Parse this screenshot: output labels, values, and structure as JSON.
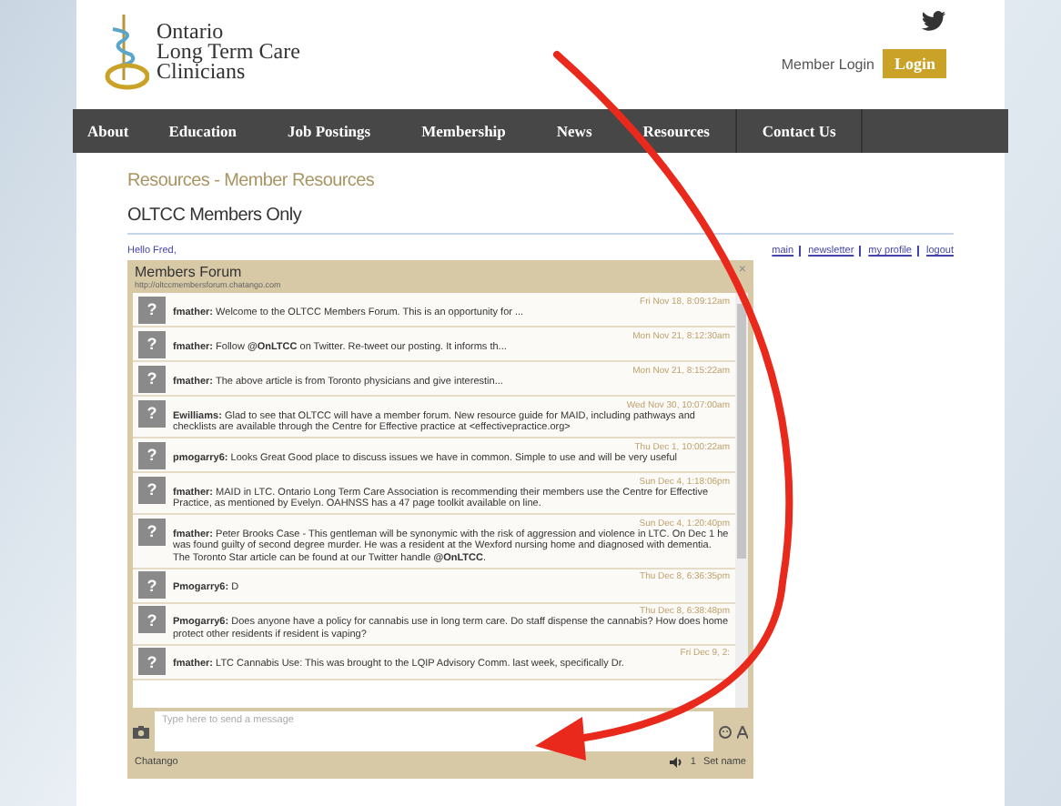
{
  "header": {
    "logo_lines": [
      "Ontario",
      "Long Term Care",
      "Clinicians"
    ],
    "member_login": "Member Login",
    "login_button": "Login"
  },
  "nav": [
    "About",
    "Education",
    "Job Postings",
    "Membership",
    "News",
    "Resources",
    "Contact Us"
  ],
  "page": {
    "breadcrumb": "Resources - Member Resources",
    "title": "OLTCC Members Only",
    "greeting": "Hello Fred,",
    "links": [
      "main",
      "newsletter",
      "my profile",
      "logout"
    ]
  },
  "forum": {
    "title": "Members Forum",
    "url": "http://oltccmembersforum.chatango.com",
    "close": "×",
    "avatar": "?",
    "messages": [
      {
        "user": "fmather:",
        "text": "Welcome to the OLTCC Members Forum. This is an opportunity for ...",
        "time": "Fri Nov 18, 8:09:12am"
      },
      {
        "user": "fmather:",
        "text": "Follow **@OnLTCC** on Twitter. Re-tweet our posting. It informs th...",
        "time": "Mon Nov 21, 8:12:30am"
      },
      {
        "user": "fmather:",
        "text": "The above article is from Toronto physicians and give interestin...",
        "time": "Mon Nov 21, 8:15:22am"
      },
      {
        "user": "Ewilliams:",
        "text": "Glad to see that OLTCC will have a member forum. New resource guide for MAID, including pathways and checklists are available through the Centre for Effective practice at <effectivepractice.org>",
        "time": "Wed Nov 30, 10:07:00am"
      },
      {
        "user": "pmogarry6:",
        "text": "Looks Great Good place to discuss issues we have in common. Simple to use and will be very useful",
        "time": "Thu Dec 1, 10:00:22am"
      },
      {
        "user": "fmather:",
        "text": "MAID in LTC. Ontario Long Term Care Association is recommending their members use the Centre for Effective Practice, as mentioned by Evelyn. OAHNSS has a 47 page toolkit available on line.",
        "time": "Sun Dec 4, 1:18:06pm"
      },
      {
        "user": "fmather:",
        "text": "Peter Brooks Case - This gentleman will be synonymic with the risk of aggression and violence in LTC. On Dec 1 he was found guilty of second degree murder. He was a resident at the Wexford nursing home and diagnosed with dementia. The Toronto Star article can be found at our Twitter handle **@OnLTCC**.",
        "time": "Sun Dec 4, 1:20:40pm"
      },
      {
        "user": "Pmogarry6:",
        "text": "D",
        "time": "Thu Dec 8, 6:36:35pm"
      },
      {
        "user": "Pmogarry6:",
        "text": "Does anyone have a policy for cannabis use in long term care. Do staff dispense the cannabis? How does home protect other residents if resident is vaping?",
        "time": "Thu Dec 8, 6:38:48pm"
      },
      {
        "user": "fmather:",
        "text": "LTC Cannabis Use: This was brought to the LQIP Advisory Comm. last week, specifically Dr.",
        "time": "Fri Dec 9, 2:"
      }
    ],
    "placeholder": "Type here to send a message",
    "footer_brand": "Chatango",
    "user_count": "1",
    "set_name": "Set name"
  }
}
